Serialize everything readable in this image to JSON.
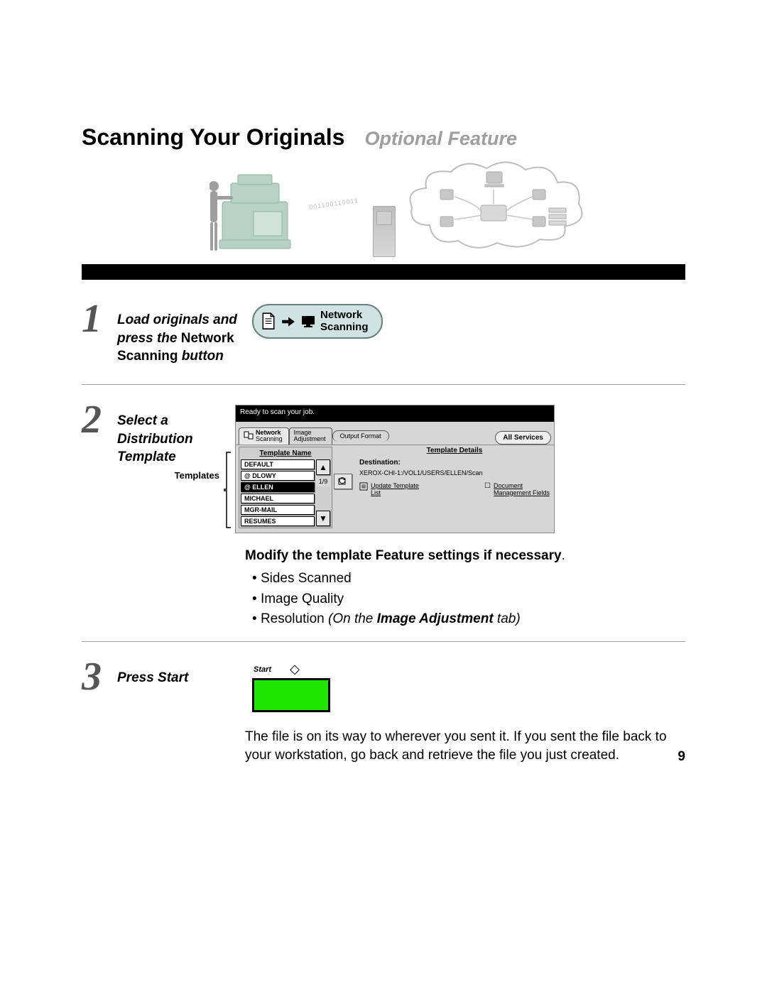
{
  "header": {
    "title": "Scanning Your Originals",
    "subtitle": "Optional Feature"
  },
  "illustration": {
    "binary": "001100110011"
  },
  "step1": {
    "num": "1",
    "text_load": "Load originals and press the",
    "text_btn_name": "Network Scanning",
    "text_btn_suffix": "button",
    "button_line1": "Network",
    "button_line2": "Scanning"
  },
  "step2": {
    "num": "2",
    "text": "Select a Distribution Template",
    "templates_label": "Templates",
    "screen": {
      "status": "Ready to scan your job.",
      "tabs": {
        "t1a": "Network",
        "t1b": "Scanning",
        "t2a": "Image",
        "t2b": "Adjustment",
        "t3": "Output Format",
        "all": "All Services"
      },
      "left_header": "Template Name",
      "templates": [
        "DEFAULT",
        "@ DLOWY",
        "@ ELLEN",
        "MICHAEL",
        "MGR-MAIL",
        "RESUMES"
      ],
      "selected_index": 2,
      "page_indicator": "1/9",
      "right_header": "Template Details",
      "dest_label": "Destination:",
      "dest_path": "XEROX-CHI-1:/VOL1/USERS/ELLEN/Scan",
      "link1a": "Update Template",
      "link1b": "List",
      "link2a": "Document",
      "link2b": "Management Fields"
    },
    "modify_heading": "Modify the template Feature settings if necessary",
    "bullets": {
      "b1": "Sides Scanned",
      "b2": "Image Quality",
      "b3_pre": "Resolution ",
      "b3_itl_a": "On the ",
      "b3_bold": "Image Adjustment",
      "b3_itl_b": " tab"
    }
  },
  "step3": {
    "num": "3",
    "text": "Press Start",
    "start_label": "Start",
    "paragraph": "The file is on its way to wherever you sent it. If you sent the file back to your workstation, go back and retrieve the file you just created."
  },
  "page_number": "9"
}
